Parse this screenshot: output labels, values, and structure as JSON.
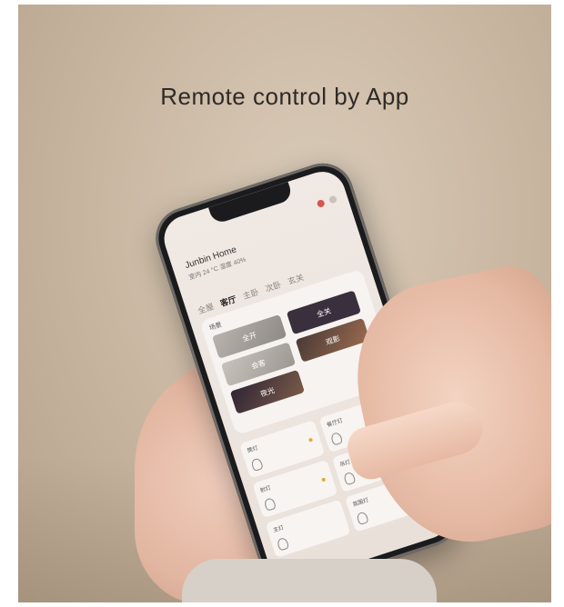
{
  "headline": "Remote control by App",
  "app": {
    "home_name": "Junbin Home",
    "subtitle": "室内 24 °C 湿度 40%",
    "tabs": [
      "全屋",
      "客厅",
      "主卧",
      "次卧",
      "玄关"
    ],
    "active_tab": "客厅",
    "scene_panel_title": "场景",
    "scenes": [
      "全开",
      "全关",
      "夜光",
      "会客",
      "观影"
    ],
    "devices": [
      "筒灯",
      "餐厅灯",
      "射灯",
      "吊灯",
      "主灯",
      "氛围灯"
    ]
  },
  "colors": {
    "scene_dark": "#3a2f3d",
    "scene_warm": "#7a5a48",
    "status_on": "#e8a33d"
  }
}
